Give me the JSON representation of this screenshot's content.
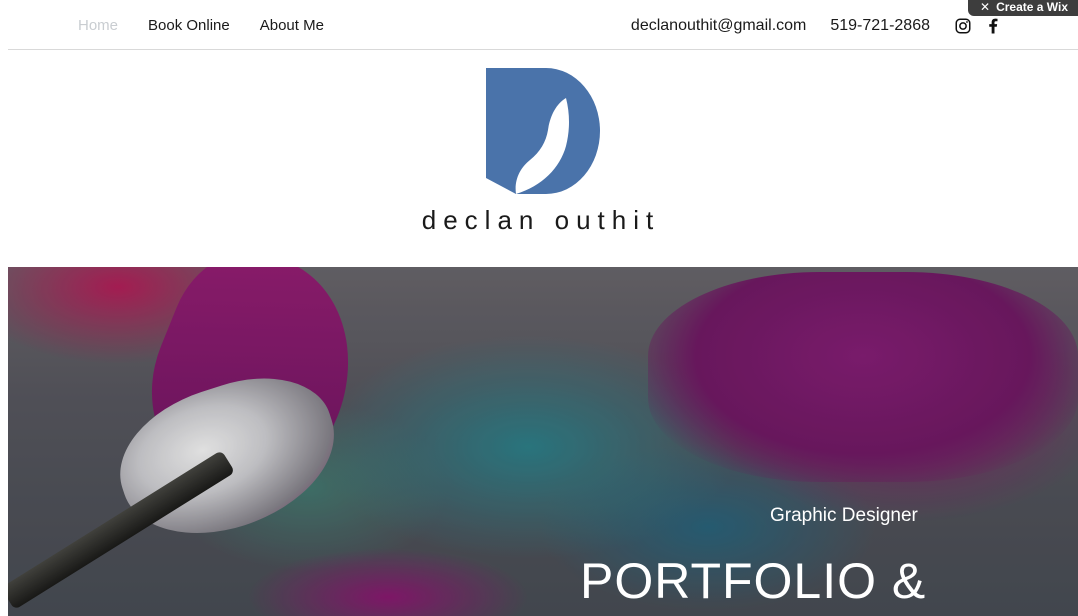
{
  "nav": {
    "items": [
      {
        "label": "Home",
        "active": true
      },
      {
        "label": "Book Online",
        "active": false
      },
      {
        "label": "About Me",
        "active": false
      }
    ]
  },
  "contact": {
    "email": "declanouthit@gmail.com",
    "phone": "519-721-2868"
  },
  "social": [
    {
      "icon": "instagram-icon"
    },
    {
      "icon": "facebook-icon"
    }
  ],
  "wix_badge": {
    "label": "Create a Wix"
  },
  "brand": {
    "name": "declan outhit",
    "logo_color": "#4a73aa"
  },
  "hero": {
    "subtitle": "Graphic Designer",
    "title": "PORTFOLIO &"
  }
}
